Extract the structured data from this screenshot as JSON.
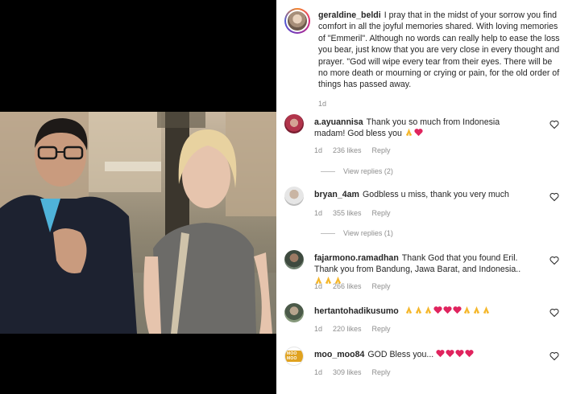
{
  "caption": {
    "username": "geraldine_beldi",
    "text": "I pray that in the midst of your sorrow you find comfort in all the joyful memories shared. With loving memories of \"Emmeril\". Although no words can really help to ease the loss you bear, just know that you are very close in every thought and prayer. \"God will wipe every tear from their eyes. There will be no more death or mourning or crying or pain, for the old order of things has passed away.",
    "time": "1d"
  },
  "comments": [
    {
      "username": "a.ayuannisa",
      "text": "Thank you so much from Indonesia madam! God bless you",
      "emoji": [
        "folded-hands",
        "heart"
      ],
      "time": "1d",
      "likes": "236 likes",
      "reply": "Reply",
      "view_replies": "View replies (2)"
    },
    {
      "username": "bryan_4am",
      "text": "Godbless u miss, thank you very much",
      "emoji": [],
      "time": "1d",
      "likes": "355 likes",
      "reply": "Reply",
      "view_replies": "View replies (1)"
    },
    {
      "username": "fajarmono.ramadhan",
      "text": "Thank God that you found Eril. Thank you from Bandung, Jawa Barat, and Indonesia..",
      "emoji": [
        "folded-hands",
        "folded-hands",
        "folded-hands"
      ],
      "time": "1d",
      "likes": "266 likes",
      "reply": "Reply"
    },
    {
      "username": "hertantohadikusumo",
      "text": "",
      "emoji": [
        "folded-hands",
        "folded-hands",
        "folded-hands",
        "heart",
        "heart",
        "heart",
        "folded-hands",
        "folded-hands",
        "folded-hands"
      ],
      "time": "1d",
      "likes": "220 likes",
      "reply": "Reply"
    },
    {
      "username": "moo_moo84",
      "text": "GOD Bless you...",
      "emoji": [
        "heart",
        "heart",
        "heart",
        "heart"
      ],
      "time": "1d",
      "likes": "309 likes",
      "reply": "Reply",
      "avatar_tag": "MOO MOO"
    }
  ],
  "colors": {
    "text": "#262626",
    "muted": "#8e8e8e",
    "heart_red": "#e0245e",
    "hands_yellow": "#f5b72c"
  },
  "icons": {
    "like": "heart-outline-icon",
    "emoji_heart": "red-heart-emoji",
    "emoji_pray": "folded-hands-emoji"
  }
}
